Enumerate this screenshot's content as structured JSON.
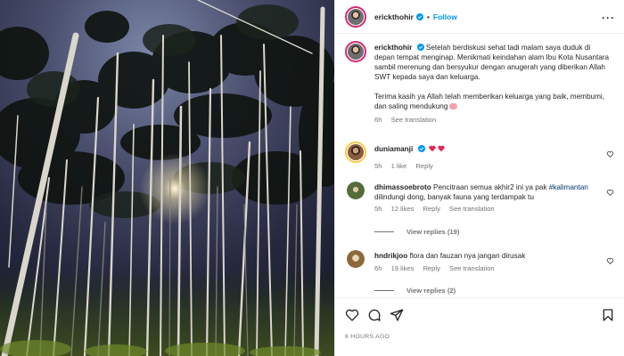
{
  "post": {
    "username": "erickthohir",
    "follow_label": "Follow",
    "dot": "•",
    "more_label": "···",
    "caption_username": "erickthohir",
    "caption_p1": "Setelah berdiskusi sehat tadi malam saya duduk di depan tempat menginap. Menikmati keindahan alam Ibu Kota Nusantara sambil merenung dan bersyukur dengan anugerah yang diberikan Allah SWT kepada saya dan keluarga.",
    "caption_p2": "Terima kasih ya Allah telah memberikan keluarga yang baik, membumi, dan saling mendukung",
    "caption_time": "6h",
    "see_translation": "See translation",
    "timestamp": "6 HOURS AGO"
  },
  "comments": [
    {
      "username": "duniamanji",
      "text": "",
      "time": "5h",
      "likes": "1 like",
      "reply": "Reply"
    },
    {
      "username": "dhimassoebroto",
      "text_before": "Pencitraan semua akhir2 ini ya pak",
      "hashtag": "#kalimantan",
      "text_after": "dilindungi dong, banyak fauna yang terdampak tu",
      "time": "5h",
      "likes": "12 likes",
      "reply": "Reply",
      "see_translation": "See translation",
      "view_replies": "View replies (19)"
    },
    {
      "username": "hndrikjoo",
      "text": "flora dan fauzan nya jangan dirusak",
      "time": "6h",
      "likes": "19 likes",
      "reply": "Reply",
      "see_translation": "See translation",
      "view_replies": "View replies (2)"
    }
  ],
  "icons": {
    "like": "heart-icon",
    "comment": "comment-icon",
    "share": "share-icon",
    "save": "bookmark-icon"
  },
  "colors": {
    "accent": "#0095f6",
    "verified": "#0095f6",
    "text": "#262626",
    "muted": "#737373",
    "heart_red": "#ff3040"
  }
}
